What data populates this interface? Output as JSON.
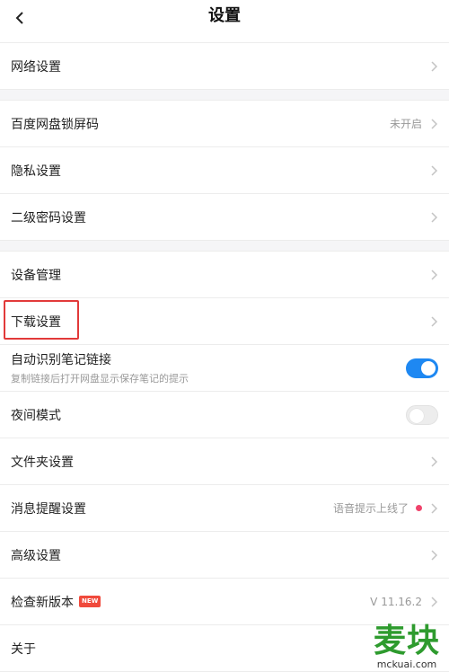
{
  "header": {
    "title": "设置",
    "back_icon": "chevron-left-icon"
  },
  "colors": {
    "accent": "#1e88f2",
    "highlight": "#e23a3a",
    "dot": "#f0436b",
    "badge": "#f04a3c",
    "watermark": "#2e9b2e"
  },
  "sections": {
    "network": {
      "label": "网络设置"
    },
    "lock": {
      "label": "百度网盘锁屏码",
      "value": "未开启"
    },
    "privacy": {
      "label": "隐私设置"
    },
    "secondary_password": {
      "label": "二级密码设置"
    },
    "devices": {
      "label": "设备管理"
    },
    "download": {
      "label": "下载设置"
    },
    "auto_note": {
      "label": "自动识别笔记链接",
      "sub": "复制链接后打开网盘显示保存笔记的提示",
      "enabled": true
    },
    "night_mode": {
      "label": "夜间模式",
      "enabled": false
    },
    "folder": {
      "label": "文件夹设置"
    },
    "notifications": {
      "label": "消息提醒设置",
      "value": "语音提示上线了"
    },
    "advanced": {
      "label": "高级设置"
    },
    "update": {
      "label": "检查新版本",
      "badge": "NEW",
      "value": "V 11.16.2"
    },
    "about": {
      "label": "关于"
    }
  },
  "watermark": {
    "big": "麦块",
    "small": "mckuai.com"
  }
}
